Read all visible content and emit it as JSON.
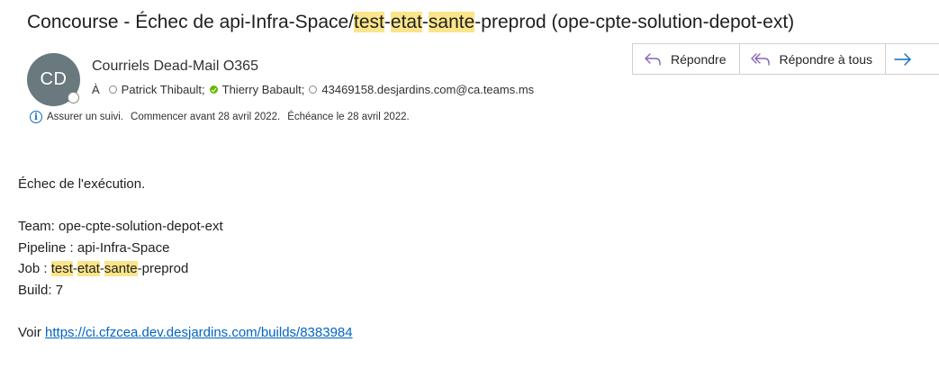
{
  "subject": {
    "prefix": "Concourse - Échec de api-Infra-Space/",
    "hl1": "test",
    "dash1": "-",
    "hl2": "etat",
    "dash2": "-",
    "hl3": "sante",
    "suffix": "-preprod (ope-cpte-solution-depot-ext)"
  },
  "avatar": {
    "initials": "CD"
  },
  "sender": {
    "name": "Courriels Dead-Mail O365"
  },
  "recipients": {
    "label": "À",
    "list": [
      {
        "name": "Patrick Thibault;",
        "status": "unknown"
      },
      {
        "name": "Thierry Babault;",
        "status": "online"
      },
      {
        "name": "43469158.desjardins.com@ca.teams.ms",
        "status": "unknown"
      }
    ]
  },
  "followup": {
    "text1": "Assurer un suivi.",
    "text2": "Commencer avant 28 avril 2022.",
    "text3": "Échéance le 28 avril 2022."
  },
  "actions": {
    "reply": "Répondre",
    "reply_all": "Répondre à tous",
    "forward": ""
  },
  "colors": {
    "highlight": "#fbe58a",
    "accent": "#0f6cbd",
    "reply_icon": "#8764b8",
    "link": "#0563c1"
  },
  "body": {
    "line1": "Échec de l'exécution.",
    "team": "Team: ope-cpte-solution-depot-ext",
    "pipeline": "Pipeline : api-Infra-Space",
    "job_prefix": "Job : ",
    "job_hl1": "test",
    "job_dash1": "-",
    "job_hl2": "etat",
    "job_dash2": "-",
    "job_hl3": "sante",
    "job_suffix": "-preprod",
    "build": "Build: 7",
    "see_label": "Voir ",
    "link": "https://ci.cfzcea.dev.desjardins.com/builds/8383984"
  }
}
